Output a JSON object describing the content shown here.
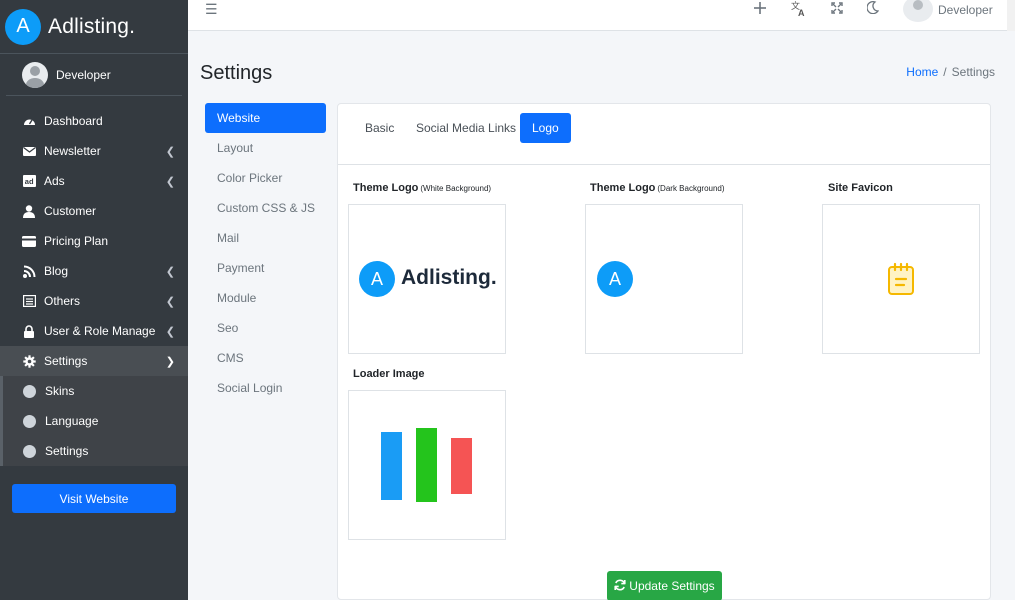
{
  "brand": {
    "logo_letter": "A",
    "name": "Adlisting."
  },
  "user": {
    "name": "Developer"
  },
  "sidebar": {
    "items": [
      {
        "label": "Dashboard",
        "icon": "dashboard-icon",
        "chevron": false
      },
      {
        "label": "Newsletter",
        "icon": "envelope-icon",
        "chevron": true
      },
      {
        "label": "Ads",
        "icon": "ad-icon",
        "chevron": true
      },
      {
        "label": "Customer",
        "icon": "user-icon",
        "chevron": false
      },
      {
        "label": "Pricing Plan",
        "icon": "credit-card-icon",
        "chevron": false
      },
      {
        "label": "Blog",
        "icon": "blog-icon",
        "chevron": true
      },
      {
        "label": "Others",
        "icon": "list-icon",
        "chevron": true
      },
      {
        "label": "User & Role Manage",
        "icon": "lock-icon",
        "chevron": true
      },
      {
        "label": "Settings",
        "icon": "gear-icon",
        "chevron": true
      }
    ],
    "sub_items": [
      {
        "label": "Skins"
      },
      {
        "label": "Language"
      },
      {
        "label": "Settings"
      }
    ],
    "visit_label": "Visit Website"
  },
  "topbar": {
    "user_name": "Developer"
  },
  "page": {
    "title": "Settings"
  },
  "breadcrumb": {
    "home": "Home",
    "separator": "/",
    "current": "Settings"
  },
  "settings_menu": [
    {
      "label": "Website",
      "active": true
    },
    {
      "label": "Layout"
    },
    {
      "label": "Color Picker"
    },
    {
      "label": "Custom CSS & JS"
    },
    {
      "label": "Mail"
    },
    {
      "label": "Payment"
    },
    {
      "label": "Module"
    },
    {
      "label": "Seo"
    },
    {
      "label": "CMS"
    },
    {
      "label": "Social Login"
    }
  ],
  "tabs": [
    {
      "label": "Basic"
    },
    {
      "label": "Social Media Links"
    },
    {
      "label": "Logo",
      "active": true
    }
  ],
  "logos": {
    "white": {
      "title": "Theme Logo",
      "note": "(White Background)",
      "letter": "A",
      "wordmark": "Adlisting."
    },
    "dark": {
      "title": "Theme Logo",
      "note": "(Dark Background)",
      "letter": "A"
    },
    "favicon": {
      "title": "Site Favicon"
    },
    "loader": {
      "title": "Loader Image"
    }
  },
  "update_label": "Update Settings",
  "colors": {
    "primary": "#0d6efd",
    "brand_blue": "#0d9cf8",
    "success": "#28a745",
    "sidebar_bg": "#343a40"
  }
}
